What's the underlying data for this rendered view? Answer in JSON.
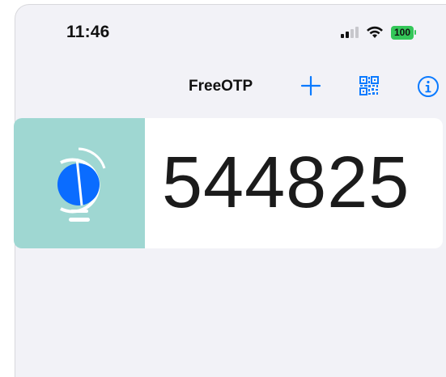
{
  "status_bar": {
    "time": "11:46",
    "battery": "100",
    "signal_icon": "cellular-signal-icon",
    "wifi_icon": "wifi-icon",
    "battery_color": "#34c759"
  },
  "nav_bar": {
    "title": "FreeOTP",
    "add_icon": "plus-icon",
    "scan_icon": "qr-code-icon",
    "info_icon": "info-icon",
    "accent_color": "#0a7aff"
  },
  "tokens": [
    {
      "code": "544825",
      "logo_icon": "freeotp-logo-icon",
      "logo_background": "#9fd7d2"
    }
  ]
}
